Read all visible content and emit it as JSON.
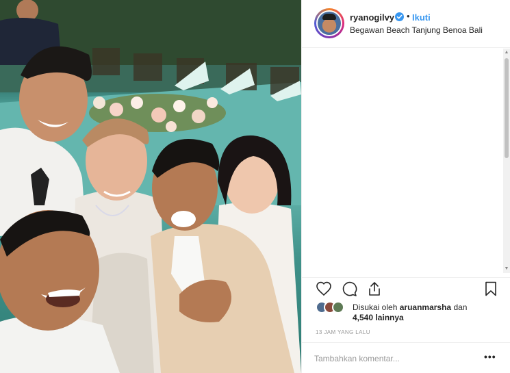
{
  "post": {
    "username": "ryanogilvy",
    "separator": "•",
    "follow_label": "Ikuti",
    "location": "Begawan Beach Tanjung Benoa Bali",
    "likes_prefix": "Disukai oleh",
    "liked_by_user": "aruanmarsha",
    "likes_conjunction": "dan",
    "likes_others": "4,540 lainnya",
    "timestamp": "13 JAM YANG LALU",
    "comment_placeholder": "Tambahkan komentar...",
    "more_label": "•••"
  },
  "icons": {
    "like": "heart-icon",
    "comment": "comment-icon",
    "share": "share-icon",
    "save": "bookmark-icon",
    "verified": "verified-badge-icon"
  },
  "colors": {
    "link_blue": "#3897f0",
    "verified_blue": "#3897f0",
    "border": "#efefef",
    "muted_text": "#999999"
  }
}
